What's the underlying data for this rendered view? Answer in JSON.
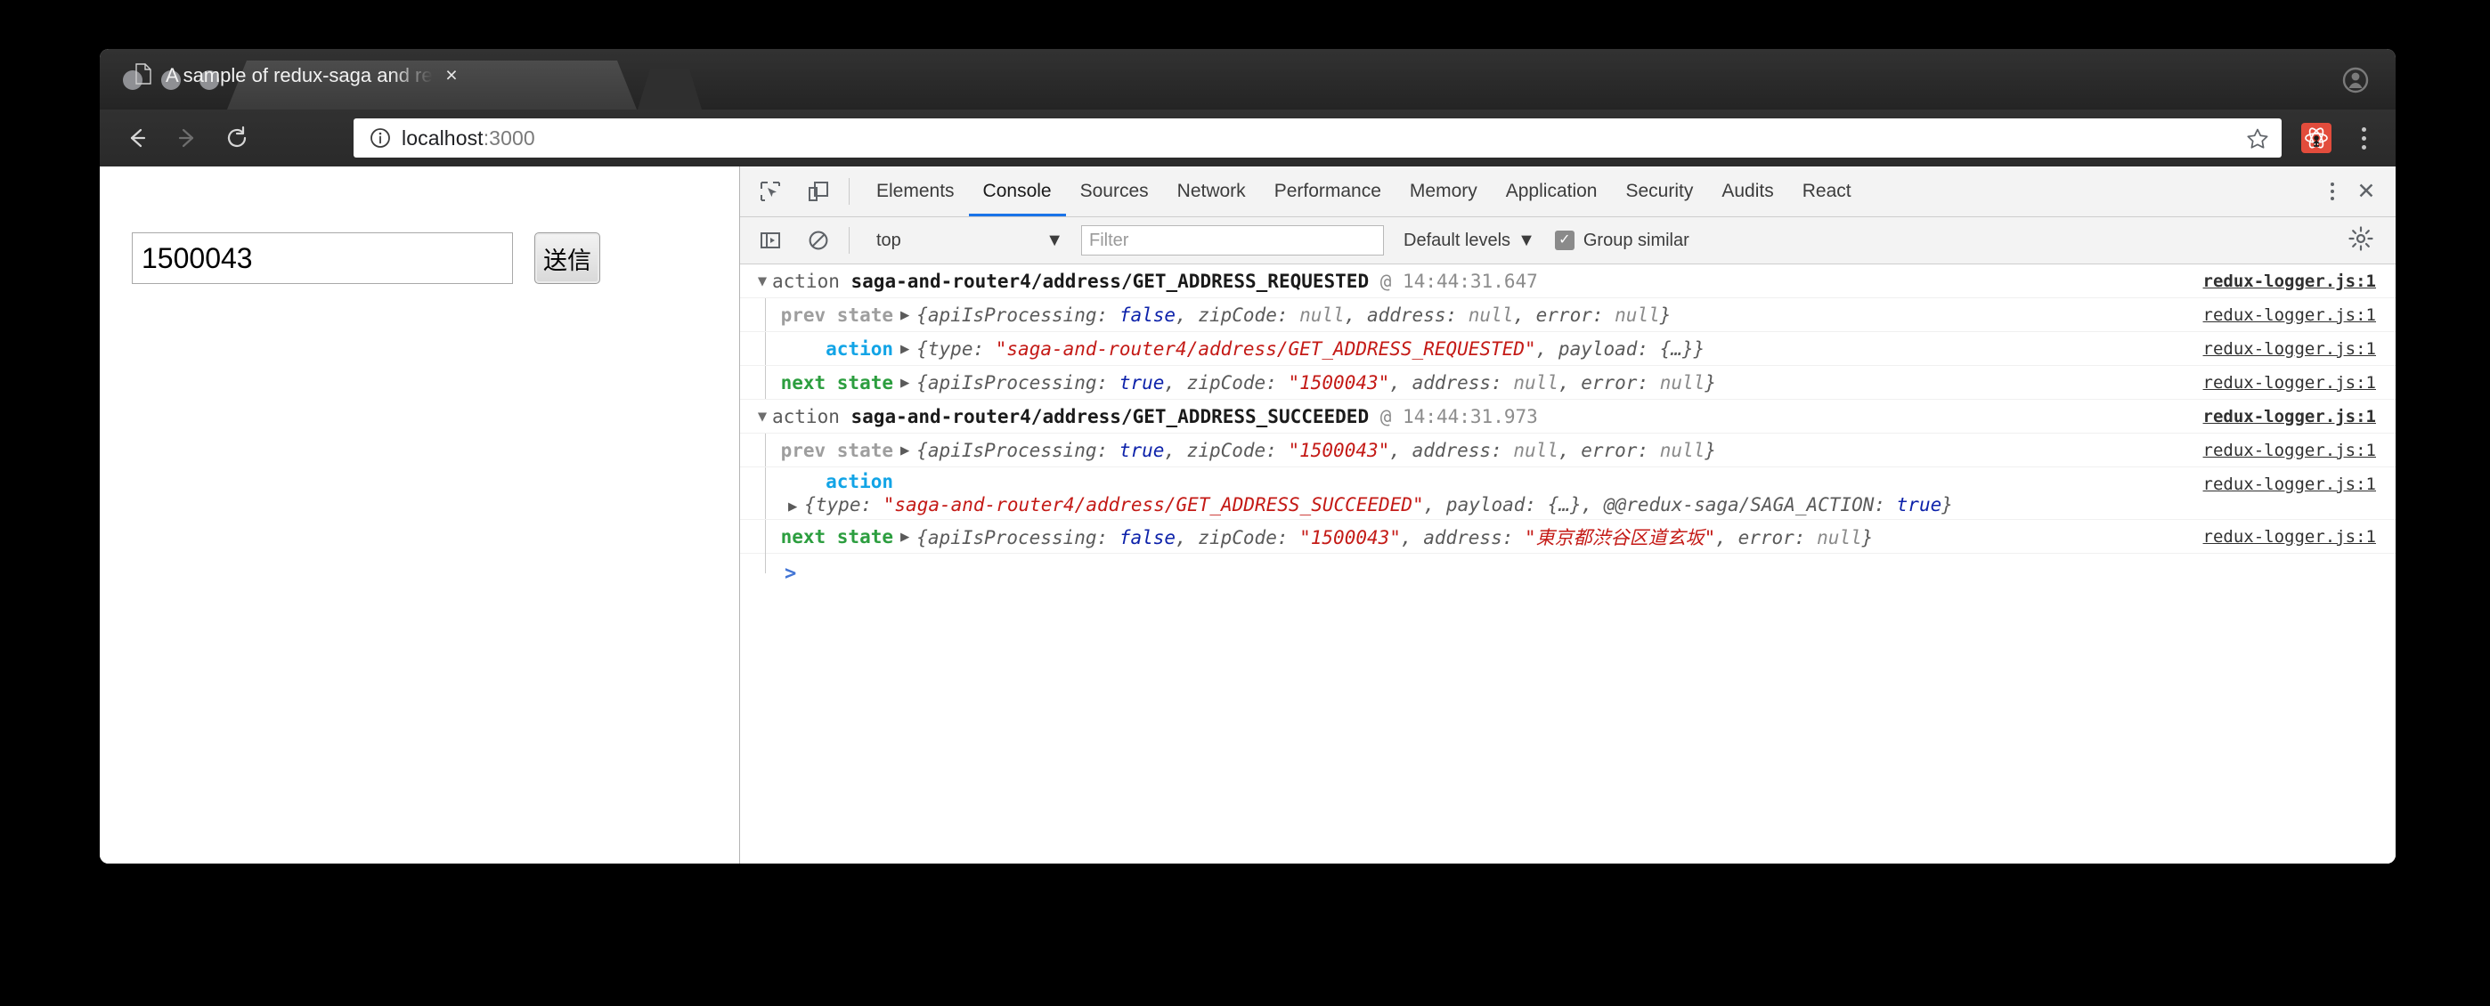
{
  "browser": {
    "tab": {
      "title": "A sample of redux-saga and redux",
      "close_label": "×",
      "page_icon": "page-icon"
    },
    "toolbar": {
      "back_icon": "back-arrow-icon",
      "forward_icon": "forward-arrow-icon",
      "reload_icon": "reload-icon",
      "info_icon": "info-circle-icon",
      "url_host": "localhost",
      "url_port": ":3000",
      "star_icon": "bookmark-star-icon",
      "extension_icon": "react-devtools-extension-icon",
      "menu_icon": "chrome-menu-icon"
    },
    "profile_icon": "profile-avatar-icon"
  },
  "page": {
    "zip_input_value": "1500043",
    "zip_input_placeholder": "",
    "submit_label": "送信"
  },
  "devtools": {
    "inspect_icon": "inspect-element-icon",
    "device_icon": "device-toolbar-icon",
    "tabs": [
      {
        "label": "Elements",
        "active": false
      },
      {
        "label": "Console",
        "active": true
      },
      {
        "label": "Sources",
        "active": false
      },
      {
        "label": "Network",
        "active": false
      },
      {
        "label": "Performance",
        "active": false
      },
      {
        "label": "Memory",
        "active": false
      },
      {
        "label": "Application",
        "active": false
      },
      {
        "label": "Security",
        "active": false
      },
      {
        "label": "Audits",
        "active": false
      },
      {
        "label": "React",
        "active": false
      }
    ],
    "more_icon": "devtools-more-icon",
    "close_icon": "devtools-close-icon",
    "filterbar": {
      "sidebar_toggle_icon": "console-sidebar-toggle-icon",
      "clear_icon": "clear-console-icon",
      "context": "top",
      "context_caret": "▼",
      "filter_placeholder": "Filter",
      "filter_value": "",
      "levels_label": "Default levels",
      "levels_caret": "▼",
      "group_similar_label": "Group similar",
      "group_similar_checked": true,
      "check_glyph": "✓",
      "settings_icon": "devtools-settings-gear-icon"
    },
    "source_link": "redux-logger.js:1",
    "prompt_glyph": ">",
    "groups": [
      {
        "twisty": "▼",
        "prefix": "action",
        "action_type": "saga-and-router4/address/GET_ADDRESS_REQUESTED",
        "at": "@ 14:44:31.647",
        "rows": [
          {
            "label": "prev state",
            "label_kind": "prev",
            "arrow": "▶",
            "parts": [
              {
                "t": "{apiIsProcessing: ",
                "c": "key"
              },
              {
                "t": "false",
                "c": "bool"
              },
              {
                "t": ", zipCode: ",
                "c": "key"
              },
              {
                "t": "null",
                "c": "nul"
              },
              {
                "t": ", address: ",
                "c": "key"
              },
              {
                "t": "null",
                "c": "nul"
              },
              {
                "t": ", error: ",
                "c": "key"
              },
              {
                "t": "null",
                "c": "nul"
              },
              {
                "t": "}",
                "c": "key"
              }
            ]
          },
          {
            "label": "action",
            "label_kind": "action",
            "arrow": "▶",
            "parts": [
              {
                "t": "{type: ",
                "c": "key"
              },
              {
                "t": "\"saga-and-router4/address/GET_ADDRESS_REQUESTED\"",
                "c": "str"
              },
              {
                "t": ", payload: {…}}",
                "c": "key"
              }
            ]
          },
          {
            "label": "next state",
            "label_kind": "next",
            "arrow": "▶",
            "parts": [
              {
                "t": "{apiIsProcessing: ",
                "c": "key"
              },
              {
                "t": "true",
                "c": "bool"
              },
              {
                "t": ", zipCode: ",
                "c": "key"
              },
              {
                "t": "\"1500043\"",
                "c": "str"
              },
              {
                "t": ", address: ",
                "c": "key"
              },
              {
                "t": "null",
                "c": "nul"
              },
              {
                "t": ", error: ",
                "c": "key"
              },
              {
                "t": "null",
                "c": "nul"
              },
              {
                "t": "}",
                "c": "key"
              }
            ]
          }
        ]
      },
      {
        "twisty": "▼",
        "prefix": "action",
        "action_type": "saga-and-router4/address/GET_ADDRESS_SUCCEEDED",
        "at": "@ 14:44:31.973",
        "rows": [
          {
            "label": "prev state",
            "label_kind": "prev",
            "arrow": "▶",
            "parts": [
              {
                "t": "{apiIsProcessing: ",
                "c": "key"
              },
              {
                "t": "true",
                "c": "bool"
              },
              {
                "t": ", zipCode: ",
                "c": "key"
              },
              {
                "t": "\"1500043\"",
                "c": "str"
              },
              {
                "t": ", address: ",
                "c": "key"
              },
              {
                "t": "null",
                "c": "nul"
              },
              {
                "t": ", error: ",
                "c": "key"
              },
              {
                "t": "null",
                "c": "nul"
              },
              {
                "t": "}",
                "c": "key"
              }
            ]
          },
          {
            "label": "action",
            "label_kind": "action",
            "arrow": "▶",
            "wrapped": true,
            "parts": [
              {
                "t": "{type: ",
                "c": "key"
              },
              {
                "t": "\"saga-and-router4/address/GET_ADDRESS_SUCCEEDED\"",
                "c": "str"
              },
              {
                "t": ", payload: {…}, @@redux-saga/SAGA_ACTION: ",
                "c": "key"
              },
              {
                "t": "true",
                "c": "bool"
              },
              {
                "t": "}",
                "c": "key"
              }
            ]
          },
          {
            "label": "next state",
            "label_kind": "next",
            "arrow": "▶",
            "parts": [
              {
                "t": "{apiIsProcessing: ",
                "c": "key"
              },
              {
                "t": "false",
                "c": "bool"
              },
              {
                "t": ", zipCode: ",
                "c": "key"
              },
              {
                "t": "\"1500043\"",
                "c": "str"
              },
              {
                "t": ", address: ",
                "c": "key"
              },
              {
                "t": "\"東京都渋谷区道玄坂\"",
                "c": "str"
              },
              {
                "t": ", error: ",
                "c": "key"
              },
              {
                "t": "null",
                "c": "nul"
              },
              {
                "t": "}",
                "c": "key"
              }
            ]
          }
        ]
      }
    ]
  }
}
